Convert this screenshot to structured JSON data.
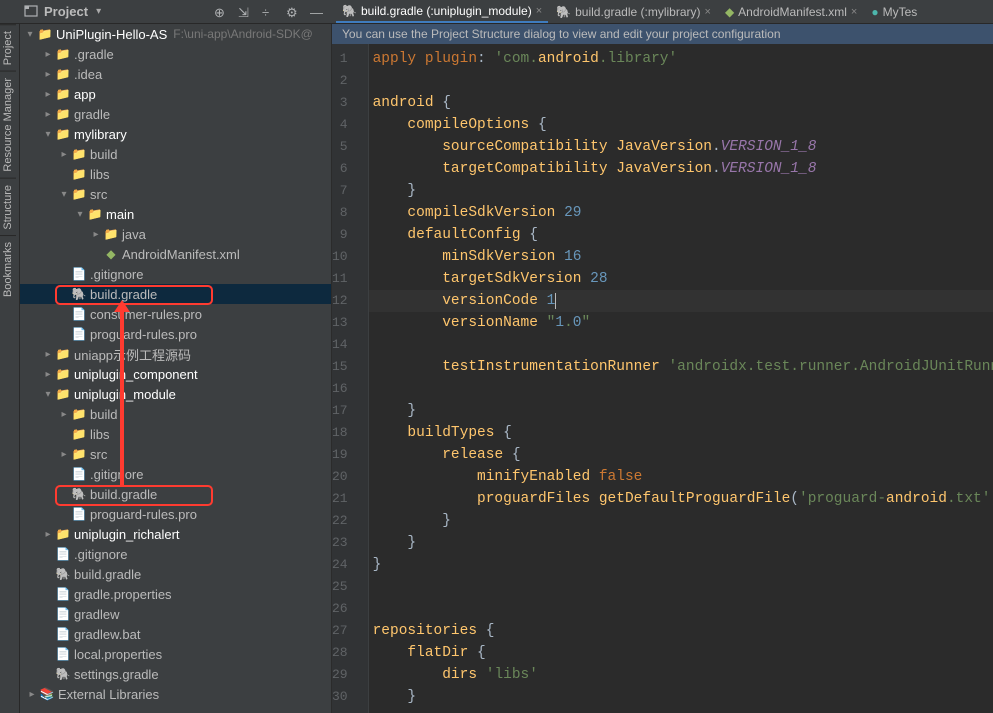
{
  "toolbar": {
    "project_label": "Project"
  },
  "tabs": [
    {
      "label": "build.gradle (:uniplugin_module)",
      "kind": "gradle",
      "active": true
    },
    {
      "label": "build.gradle (:mylibrary)",
      "kind": "gradle",
      "active": false
    },
    {
      "label": "AndroidManifest.xml",
      "kind": "xml",
      "active": false
    },
    {
      "label": "MyTes",
      "kind": "class",
      "active": false
    }
  ],
  "info_bar": "You can use the Project Structure dialog to view and edit your project configuration",
  "tree_root": {
    "label": "UniPlugin-Hello-AS",
    "path": "F:\\uni-app\\Android-SDK@"
  },
  "tree": [
    {
      "indent": 1,
      "arrow": ">",
      "icon": "orange-folder",
      "label": ".gradle"
    },
    {
      "indent": 1,
      "arrow": ">",
      "icon": "gray-folder",
      "label": ".idea"
    },
    {
      "indent": 1,
      "arrow": ">",
      "icon": "gray-folder",
      "label": "app",
      "bold": true
    },
    {
      "indent": 1,
      "arrow": ">",
      "icon": "gray-folder",
      "label": "gradle"
    },
    {
      "indent": 1,
      "arrow": "v",
      "icon": "gray-folder",
      "label": "mylibrary",
      "bold": true
    },
    {
      "indent": 2,
      "arrow": ">",
      "icon": "orange-folder",
      "label": "build"
    },
    {
      "indent": 2,
      "arrow": "",
      "icon": "gray-folder",
      "label": "libs"
    },
    {
      "indent": 2,
      "arrow": "v",
      "icon": "gray-folder",
      "label": "src"
    },
    {
      "indent": 3,
      "arrow": "v",
      "icon": "gray-folder",
      "label": "main",
      "bold": true
    },
    {
      "indent": 4,
      "arrow": ">",
      "icon": "blue-folder",
      "label": "java"
    },
    {
      "indent": 4,
      "arrow": "",
      "icon": "xml",
      "label": "AndroidManifest.xml"
    },
    {
      "indent": 2,
      "arrow": "",
      "icon": "file",
      "label": ".gitignore"
    },
    {
      "indent": 2,
      "arrow": "",
      "icon": "gradle",
      "label": "build.gradle",
      "selected": true,
      "highlight": true
    },
    {
      "indent": 2,
      "arrow": "",
      "icon": "file",
      "label": "consumer-rules.pro"
    },
    {
      "indent": 2,
      "arrow": "",
      "icon": "file",
      "label": "proguard-rules.pro"
    },
    {
      "indent": 1,
      "arrow": ">",
      "icon": "gray-folder",
      "label": "uniapp示例工程源码"
    },
    {
      "indent": 1,
      "arrow": ">",
      "icon": "gray-folder",
      "label": "uniplugin_component",
      "bold": true
    },
    {
      "indent": 1,
      "arrow": "v",
      "icon": "gray-folder",
      "label": "uniplugin_module",
      "bold": true
    },
    {
      "indent": 2,
      "arrow": ">",
      "icon": "orange-folder",
      "label": "build"
    },
    {
      "indent": 2,
      "arrow": "",
      "icon": "gray-folder",
      "label": "libs"
    },
    {
      "indent": 2,
      "arrow": ">",
      "icon": "gray-folder",
      "label": "src"
    },
    {
      "indent": 2,
      "arrow": "",
      "icon": "file",
      "label": ".gitignore"
    },
    {
      "indent": 2,
      "arrow": "",
      "icon": "gradle",
      "label": "build.gradle",
      "highlight": true
    },
    {
      "indent": 2,
      "arrow": "",
      "icon": "file",
      "label": "proguard-rules.pro"
    },
    {
      "indent": 1,
      "arrow": ">",
      "icon": "gray-folder",
      "label": "uniplugin_richalert",
      "bold": true
    },
    {
      "indent": 1,
      "arrow": "",
      "icon": "file",
      "label": ".gitignore"
    },
    {
      "indent": 1,
      "arrow": "",
      "icon": "gradle",
      "label": "build.gradle"
    },
    {
      "indent": 1,
      "arrow": "",
      "icon": "file",
      "label": "gradle.properties"
    },
    {
      "indent": 1,
      "arrow": "",
      "icon": "file",
      "label": "gradlew"
    },
    {
      "indent": 1,
      "arrow": "",
      "icon": "file",
      "label": "gradlew.bat"
    },
    {
      "indent": 1,
      "arrow": "",
      "icon": "file",
      "label": "local.properties"
    },
    {
      "indent": 1,
      "arrow": "",
      "icon": "gradle",
      "label": "settings.gradle"
    },
    {
      "indent": 0,
      "arrow": ">",
      "icon": "lib",
      "label": "External Libraries"
    }
  ],
  "side_tabs": [
    "Project",
    "Resource Manager",
    "Structure",
    "Bookmarks"
  ],
  "code_lines": [
    {
      "n": 1,
      "raw": "apply plugin: 'com.android.library'"
    },
    {
      "n": 2,
      "raw": ""
    },
    {
      "n": 3,
      "raw": "android {"
    },
    {
      "n": 4,
      "raw": "    compileOptions {"
    },
    {
      "n": 5,
      "raw": "        sourceCompatibility JavaVersion.VERSION_1_8"
    },
    {
      "n": 6,
      "raw": "        targetCompatibility JavaVersion.VERSION_1_8"
    },
    {
      "n": 7,
      "raw": "    }"
    },
    {
      "n": 8,
      "raw": "    compileSdkVersion 29"
    },
    {
      "n": 9,
      "raw": "    defaultConfig {"
    },
    {
      "n": 10,
      "raw": "        minSdkVersion 16"
    },
    {
      "n": 11,
      "raw": "        targetSdkVersion 28"
    },
    {
      "n": 12,
      "raw": "        versionCode 1"
    },
    {
      "n": 13,
      "raw": "        versionName \"1.0\""
    },
    {
      "n": 14,
      "raw": ""
    },
    {
      "n": 15,
      "raw": "        testInstrumentationRunner 'androidx.test.runner.AndroidJUnitRunner'"
    },
    {
      "n": 16,
      "raw": ""
    },
    {
      "n": 17,
      "raw": "    }"
    },
    {
      "n": 18,
      "raw": "    buildTypes {"
    },
    {
      "n": 19,
      "raw": "        release {"
    },
    {
      "n": 20,
      "raw": "            minifyEnabled false"
    },
    {
      "n": 21,
      "raw": "            proguardFiles getDefaultProguardFile('proguard-android.txt'), '"
    },
    {
      "n": 22,
      "raw": "        }"
    },
    {
      "n": 23,
      "raw": "    }"
    },
    {
      "n": 24,
      "raw": "}"
    },
    {
      "n": 25,
      "raw": ""
    },
    {
      "n": 26,
      "raw": ""
    },
    {
      "n": 27,
      "raw": "repositories {"
    },
    {
      "n": 28,
      "raw": "    flatDir {"
    },
    {
      "n": 29,
      "raw": "        dirs 'libs'"
    },
    {
      "n": 30,
      "raw": "    }"
    }
  ]
}
